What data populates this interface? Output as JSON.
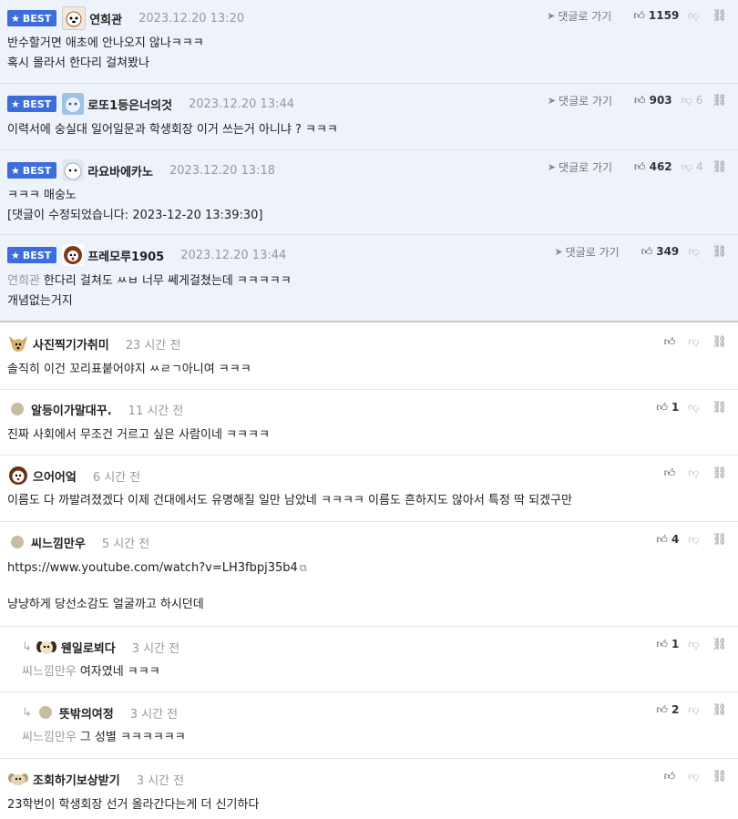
{
  "labels": {
    "best": "BEST",
    "goto": "댓글로 가기"
  },
  "icons": {
    "star": "star-icon",
    "thumb_up": "thumb-up-icon",
    "thumb_down": "thumb-down-icon",
    "link": "link-icon",
    "reply": "reply-arrow-icon",
    "goto": "send-arrow-icon"
  },
  "colors": {
    "best_bg": "#eef2fa",
    "badge": "#3d6ddb"
  },
  "best_comments": [
    {
      "nick": "연희관",
      "time": "2023.12.20 13:20",
      "likes": "1159",
      "dislikes": "",
      "lines": [
        "반수할거면 애초에 안나오지 않나ㅋㅋㅋ",
        "혹시 몰라서 한다리 걸쳐봤나"
      ]
    },
    {
      "nick": "로또1등은너의것",
      "time": "2023.12.20 13:44",
      "likes": "903",
      "dislikes": "6",
      "lines": [
        "이력서에 숭실대 일어일문과 학생회장 이거 쓰는거 아니냐 ? ㅋㅋㅋ"
      ]
    },
    {
      "nick": "라요바에카노",
      "time": "2023.12.20 13:18",
      "likes": "462",
      "dislikes": "4",
      "lines": [
        "ㅋㅋㅋ 매숭노",
        "[댓글이 수정되었습니다: 2023-12-20 13:39:30]"
      ]
    },
    {
      "nick": "프레모루1905",
      "time": "2023.12.20 13:44",
      "likes": "349",
      "dislikes": "",
      "mention": "연희관",
      "lines": [
        "한다리 걸쳐도 ㅆㅂ 너무 쎄게걸쳤는데 ㅋㅋㅋㅋㅋ",
        "개념없는거지"
      ]
    }
  ],
  "comments": [
    {
      "nick": "사진찍기가취미",
      "time": "23 시간 전",
      "likes": "",
      "lines": [
        "솔직히 이건 꼬리표붙어야지 ㅆㄹㄱ아니여 ㅋㅋㅋ"
      ]
    },
    {
      "nick": "알등이가말대꾸.",
      "time": "11 시간 전",
      "likes": "1",
      "lines": [
        "진짜 사회에서 무조건 거르고 싶은 사람이네 ㅋㅋㅋㅋ"
      ]
    },
    {
      "nick": "으어어엌",
      "time": "6 시간 전",
      "likes": "",
      "lines": [
        "이름도 다 까발려졌겠다 이제 건대에서도 유명해질 일만 남았네 ㅋㅋㅋㅋ 이름도 흔하지도 않아서 특정 딱 되겠구만"
      ]
    },
    {
      "nick": "씨느낌만우",
      "time": "5 시간 전",
      "likes": "4",
      "lines": [
        "https://www.youtube.com/watch?v=LH3fbpj35b4",
        "냥냥하게 당선소감도 얼굴까고 하시던데"
      ]
    },
    {
      "nick": "웬일로뵈다",
      "time": "3 시간 전",
      "likes": "1",
      "mention": "씨느낌만우",
      "lines": [
        "여자였네 ㅋㅋㅋ"
      ]
    },
    {
      "nick": "뜻밖의여정",
      "time": "3 시간 전",
      "likes": "2",
      "mention": "씨느낌만우",
      "lines": [
        "그 성별 ㅋㅋㅋㅋㅋㅋ"
      ]
    },
    {
      "nick": "조회하기보상받기",
      "time": "3 시간 전",
      "likes": "",
      "lines": [
        "23학번이 학생회장 선거 올라간다는게 더 신기하다"
      ]
    }
  ]
}
